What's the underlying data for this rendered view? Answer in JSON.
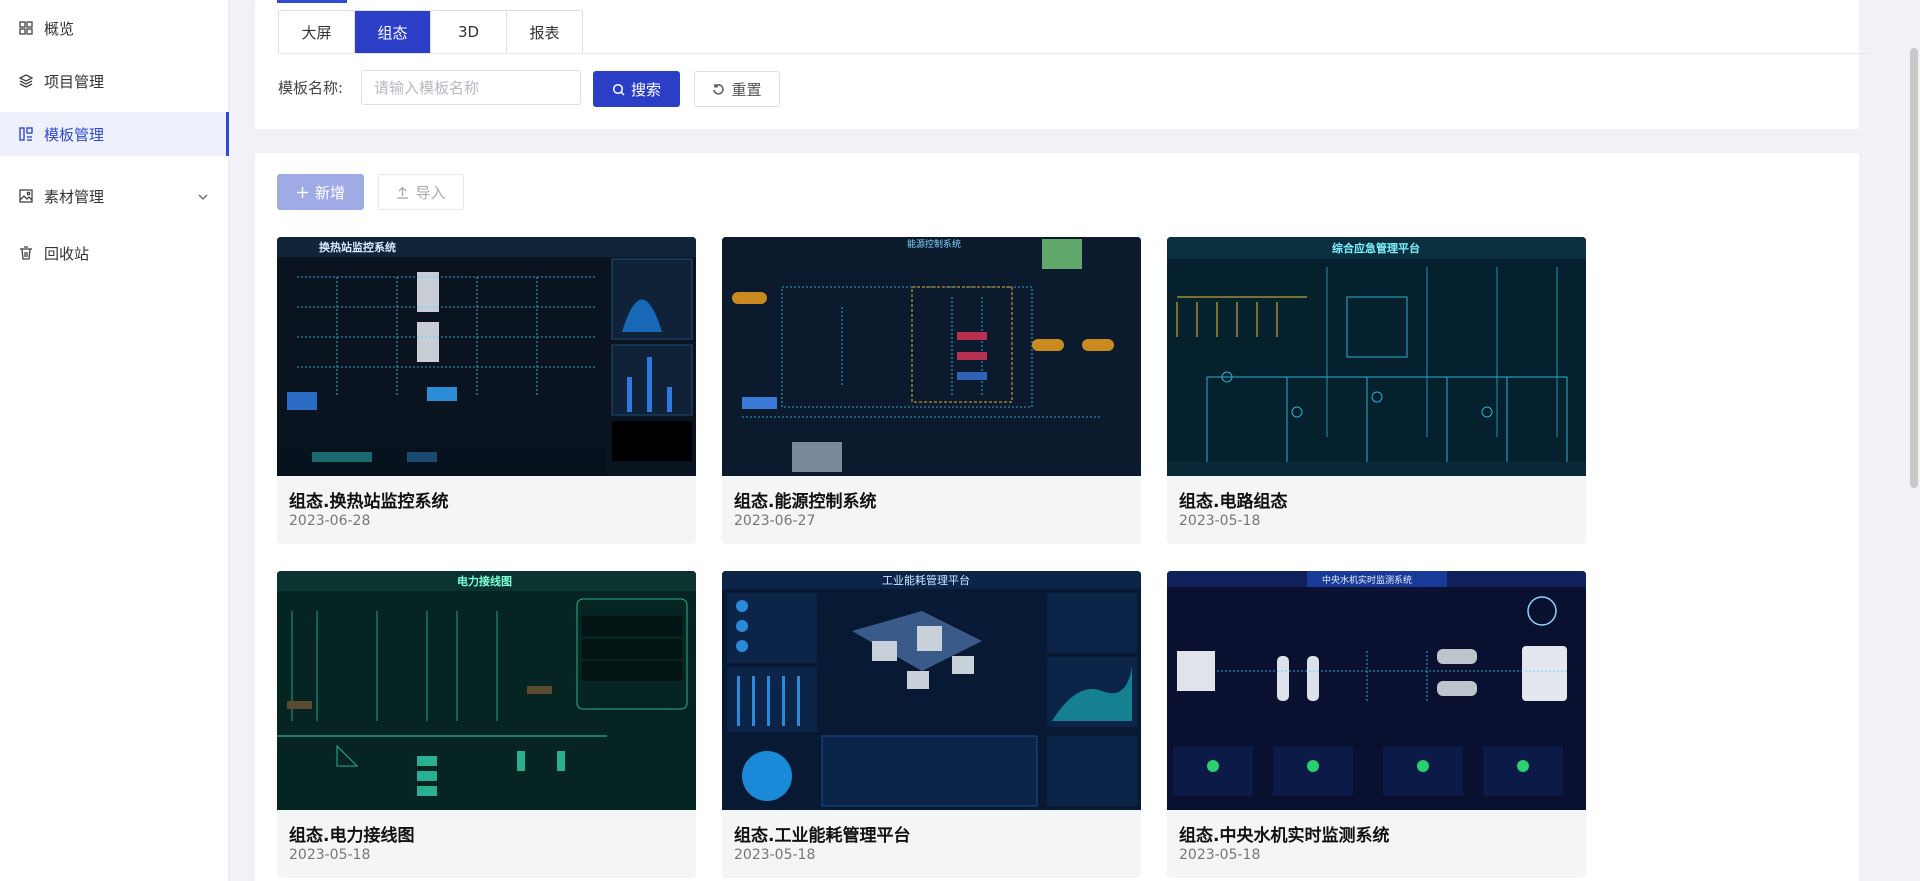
{
  "sidebar": {
    "items": [
      {
        "label": "概览",
        "icon": "grid-icon"
      },
      {
        "label": "项目管理",
        "icon": "layers-icon"
      },
      {
        "label": "模板管理",
        "icon": "template-icon",
        "active": true
      },
      {
        "label": "素材管理",
        "icon": "image-icon",
        "expandable": true
      },
      {
        "label": "回收站",
        "icon": "trash-icon"
      }
    ]
  },
  "tabs": [
    "大屏",
    "组态",
    "3D",
    "报表"
  ],
  "active_tab": "组态",
  "search": {
    "label": "模板名称:",
    "placeholder": "请输入模板名称",
    "search_button": "搜索",
    "reset_button": "重置"
  },
  "toolbar": {
    "add_button": "新增",
    "import_button": "导入"
  },
  "templates": [
    {
      "title": "组态.换热站监控系统",
      "date": "2023-06-28",
      "thumb_caption": "换热站监控系统"
    },
    {
      "title": "组态.能源控制系统",
      "date": "2023-06-27",
      "thumb_caption": "能源控制系统"
    },
    {
      "title": "组态.电路组态",
      "date": "2023-05-18",
      "thumb_caption": "综合应急管理平台"
    },
    {
      "title": "组态.电力接线图",
      "date": "2023-05-18",
      "thumb_caption": "电力接线图"
    },
    {
      "title": "组态.工业能耗管理平台",
      "date": "2023-05-18",
      "thumb_caption": "工业能耗管理平台"
    },
    {
      "title": "组态.中央水机实时监测系统",
      "date": "2023-05-18",
      "thumb_caption": "中央水机实时监测系统"
    }
  ],
  "colors": {
    "primary": "#2b3ec6",
    "primary_light": "#a0abe6",
    "thumb_bg": "#071a2e",
    "thumb_line": "#3fd0ff"
  }
}
